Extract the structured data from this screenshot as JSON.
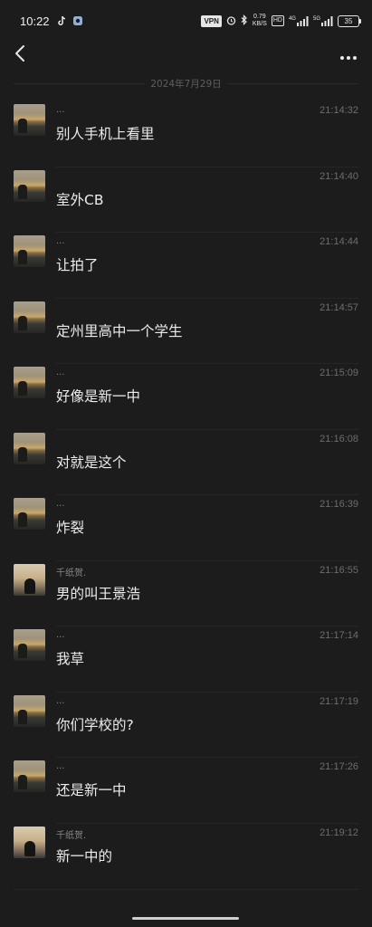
{
  "status_bar": {
    "time": "10:22",
    "vpn": "VPN",
    "net_speed_value": "0.79",
    "net_speed_unit": "KB/S",
    "hd": "HD",
    "signal1": "4G",
    "signal2": "5G",
    "battery": "35",
    "icons": [
      "tiktok-icon",
      "app-icon",
      "alarm-icon",
      "bluetooth-icon",
      "signal-icon",
      "signal-icon"
    ]
  },
  "nav": {
    "back_icon": "chevron-left-icon",
    "more_icon": "more-dots-icon"
  },
  "date_divider": "2024年7月29日",
  "messages": [
    {
      "sender": "...",
      "time": "21:14:32",
      "text": "别人手机上看里",
      "avatar": "sunset"
    },
    {
      "sender": "",
      "time": "21:14:40",
      "text": "室外CB",
      "avatar": "sunset"
    },
    {
      "sender": "...",
      "time": "21:14:44",
      "text": "让拍了",
      "avatar": "sunset"
    },
    {
      "sender": "",
      "time": "21:14:57",
      "text": "定州里高中一个学生",
      "avatar": "sunset"
    },
    {
      "sender": "...",
      "time": "21:15:09",
      "text": "好像是新一中",
      "avatar": "sunset"
    },
    {
      "sender": "",
      "time": "21:16:08",
      "text": "对就是这个",
      "avatar": "sunset"
    },
    {
      "sender": "...",
      "time": "21:16:39",
      "text": "炸裂",
      "avatar": "sunset"
    },
    {
      "sender": "千纸贺.",
      "time": "21:16:55",
      "text": "男的叫王景浩",
      "avatar": "person"
    },
    {
      "sender": "...",
      "time": "21:17:14",
      "text": "我草",
      "avatar": "sunset"
    },
    {
      "sender": "...",
      "time": "21:17:19",
      "text": "你们学校的?",
      "avatar": "sunset"
    },
    {
      "sender": "...",
      "time": "21:17:26",
      "text": "还是新一中",
      "avatar": "sunset"
    },
    {
      "sender": "千纸贺.",
      "time": "21:19:12",
      "text": "新一中的",
      "avatar": "person"
    }
  ]
}
